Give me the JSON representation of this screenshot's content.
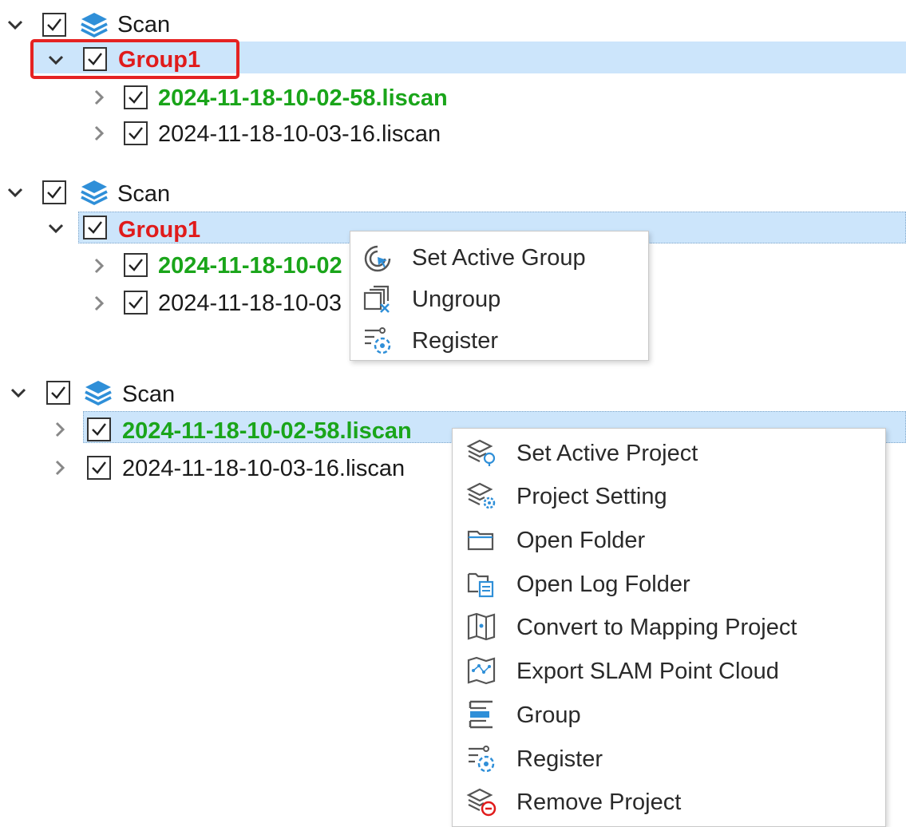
{
  "tree1": {
    "root_label": "Scan",
    "group_label": "Group1",
    "files": [
      "2024-11-18-10-02-58.liscan",
      "2024-11-18-10-03-16.liscan"
    ]
  },
  "tree2": {
    "root_label": "Scan",
    "group_label": "Group1",
    "files": [
      "2024-11-18-10-02",
      "2024-11-18-10-03"
    ],
    "context_menu": [
      "Set Active Group",
      "Ungroup",
      "Register"
    ]
  },
  "tree3": {
    "root_label": "Scan",
    "files": [
      "2024-11-18-10-02-58.liscan",
      "2024-11-18-10-03-16.liscan"
    ],
    "context_menu": [
      "Set Active Project",
      "Project Setting",
      "Open Folder",
      "Open Log Folder",
      "Convert to Mapping Project",
      "Export SLAM Point Cloud",
      "Group",
      "Register",
      "Remove Project"
    ]
  },
  "colors": {
    "selection": "#cce5fb",
    "group_text": "#e01b1b",
    "active_text": "#1aa51a",
    "highlight_box": "#e52222",
    "icon_blue": "#2f8fd8"
  },
  "icons": {
    "expanded": "chevron-down-icon",
    "collapsed": "chevron-right-icon",
    "checkbox": "checkbox-checked-icon",
    "scan": "layers-icon"
  }
}
